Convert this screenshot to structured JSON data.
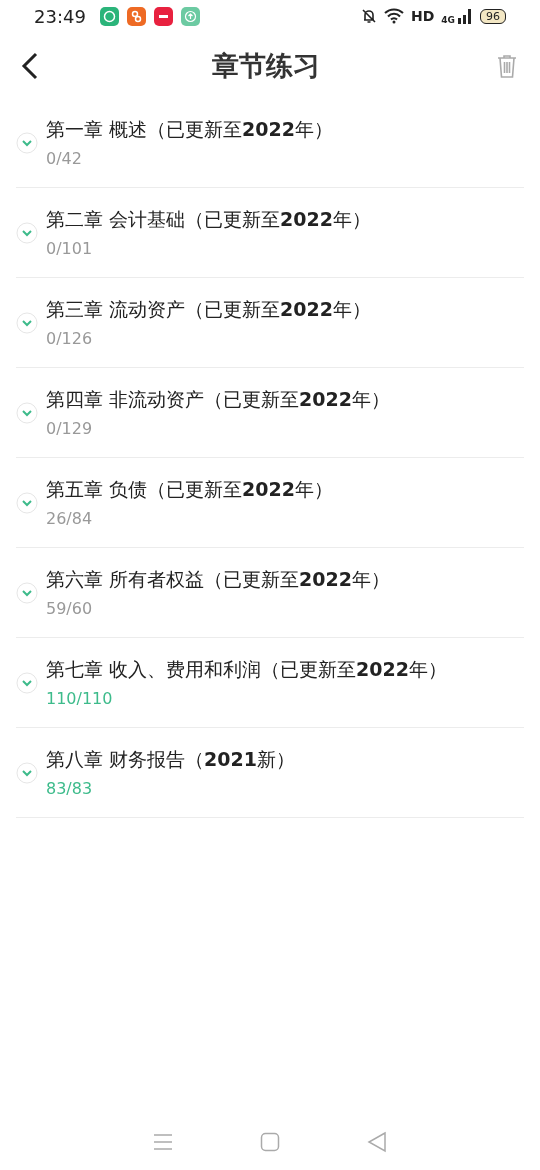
{
  "status_bar": {
    "time": "23:49",
    "network": "HD",
    "cellular": "4G",
    "battery": "96"
  },
  "header": {
    "title": "章节练习"
  },
  "chapters": [
    {
      "title": "第一章 概述（已更新至**2022**年）",
      "progress": "0/42",
      "completed": false
    },
    {
      "title": "第二章 会计基础（已更新至**2022**年）",
      "progress": "0/101",
      "completed": false
    },
    {
      "title": "第三章 流动资产（已更新至**2022**年）",
      "progress": "0/126",
      "completed": false
    },
    {
      "title": "第四章 非流动资产（已更新至**2022**年）",
      "progress": "0/129",
      "completed": false
    },
    {
      "title": "第五章 负债（已更新至**2022**年）",
      "progress": "26/84",
      "completed": false
    },
    {
      "title": "第六章 所有者权益（已更新至**2022**年）",
      "progress": "59/60",
      "completed": false
    },
    {
      "title": "第七章 收入、费用和利润（已更新至**2022**年）",
      "progress": "110/110",
      "completed": true
    },
    {
      "title": "第八章 财务报告（**2021**新）",
      "progress": "83/83",
      "completed": true
    }
  ]
}
